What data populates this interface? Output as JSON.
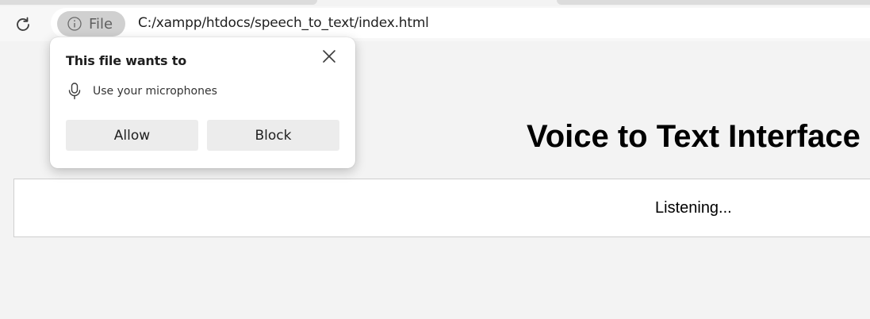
{
  "browser": {
    "site_chip_label": "File",
    "url": "C:/xampp/htdocs/speech_to_text/index.html"
  },
  "permission_popup": {
    "title": "This file wants to",
    "permission": "Use your microphones",
    "allow_label": "Allow",
    "block_label": "Block"
  },
  "page": {
    "heading": "Voice to Text Interface",
    "output_text": "Listening..."
  },
  "icons": {
    "reload": "reload-icon",
    "info": "info-icon",
    "microphone": "microphone-icon",
    "close": "close-icon"
  }
}
